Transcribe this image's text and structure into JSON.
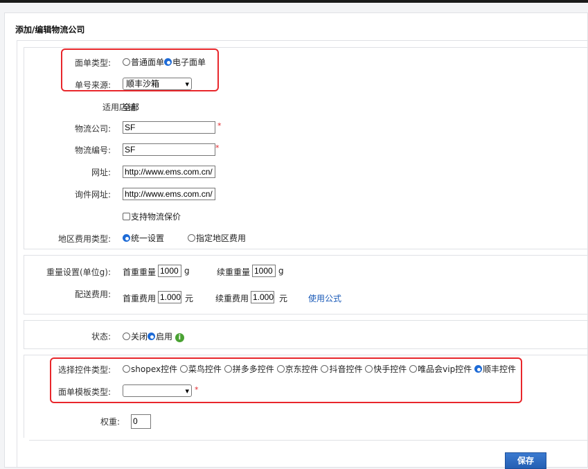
{
  "page": {
    "title": "添加/编辑物流公司"
  },
  "basic": {
    "waybill_type_label": "面单类型:",
    "waybill_options": [
      "普通面单",
      "电子面单"
    ],
    "waybill_selected": "电子面单",
    "source_label": "单号来源:",
    "source_value": "顺丰沙箱",
    "shop_label": "适用店铺:",
    "shop_value": "全部",
    "company_label": "物流公司:",
    "company_value": "SF",
    "code_label": "物流编号:",
    "code_value": "SF",
    "url_label": "网址:",
    "url_value": "http://www.ems.com.cn/",
    "query_url_label": "询件网址:",
    "query_url_value": "http://www.ems.com.cn/",
    "insure_label": "支持物流保价",
    "region_fee_label": "地区费用类型:",
    "region_options": [
      "统一设置",
      "指定地区费用"
    ],
    "region_selected": "统一设置",
    "required_mark": "*"
  },
  "weight": {
    "weight_label": "重量设置(单位g):",
    "first_weight_label": "首重重量",
    "first_weight_value": "1000",
    "first_weight_unit": "g",
    "extra_weight_label": "续重重量",
    "extra_weight_value": "1000",
    "extra_weight_unit": "g",
    "fee_label": "配送费用:",
    "first_fee_label": "首重费用",
    "first_fee_value": "1.000",
    "first_fee_unit": "元",
    "extra_fee_label": "续重费用",
    "extra_fee_value": "1.000",
    "extra_fee_unit": "元",
    "formula_link": "使用公式"
  },
  "status": {
    "label": "状态:",
    "options": [
      "关闭",
      "启用"
    ],
    "selected": "启用",
    "info_icon": "info-icon"
  },
  "control": {
    "label": "选择控件类型:",
    "options": [
      "shopex控件",
      "菜鸟控件",
      "拼多多控件",
      "京东控件",
      "抖音控件",
      "快手控件",
      "唯品会vip控件",
      "顺丰控件"
    ],
    "selected": "顺丰控件",
    "template_label": "面单模板类型:",
    "template_value": "",
    "weight_label": "权重:",
    "weight_value": "0"
  },
  "actions": {
    "save": "保存"
  },
  "colors": {
    "highlight": "#e8262b",
    "accent": "#1e6bd6",
    "link": "#1a5ab8"
  }
}
